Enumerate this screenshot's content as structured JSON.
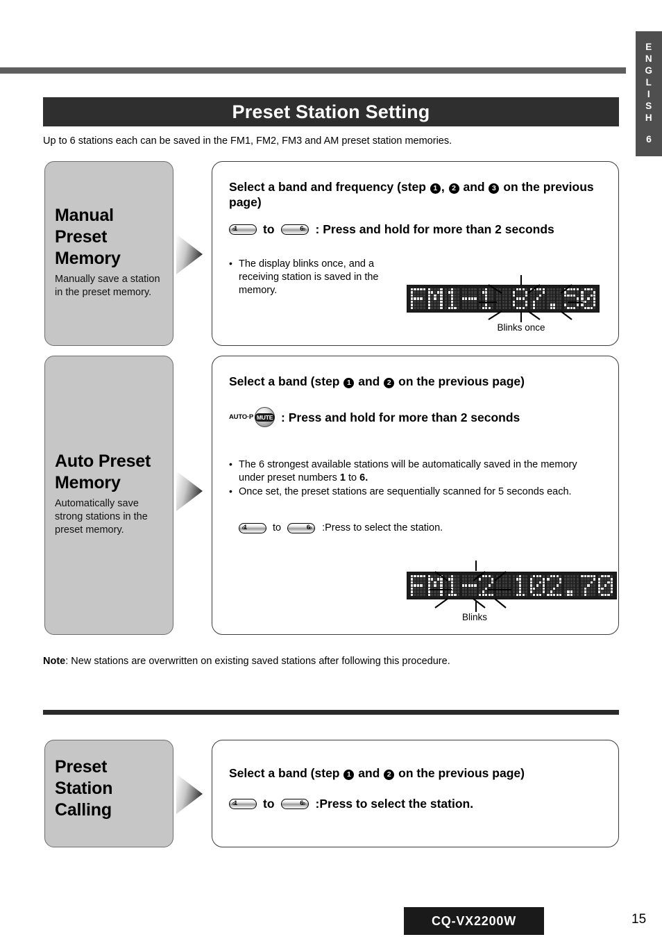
{
  "sidebar": {
    "language": "ENGLISH",
    "chapter": "6"
  },
  "header": {
    "title": "Preset Station Setting",
    "intro": "Up to 6 stations each can be saved in the FM1, FM2, FM3 and AM preset station memories."
  },
  "sections": [
    {
      "panel_title_lines": [
        "Manual",
        "Preset",
        "Memory"
      ],
      "panel_sub": "Manually save a station in the preset memory.",
      "step_head_a": "Select a band and frequency (step",
      "step_head_nums": [
        "1",
        "2",
        "3"
      ],
      "step_head_b": "on the previous page)",
      "btn_low": "1",
      "btn_high": "6",
      "to_word": "to",
      "action": ": Press and hold for more than 2 seconds",
      "bullets": [
        "The display blinks once, and a receiving station is saved in the memory."
      ],
      "display": "FM1-1  87.50",
      "display_caption": "Blinks once"
    },
    {
      "panel_title_lines": [
        "Auto Preset",
        "Memory"
      ],
      "panel_sub": "Automatically save strong stations in the preset memory.",
      "step_head_a": "Select a band (step",
      "step_head_nums": [
        "1",
        "2"
      ],
      "step_head_b": "on the previous page)",
      "autop_label": "AUTO·P",
      "mute_label": "MUTE",
      "action": ": Press and hold for more than 2 seconds",
      "bullets": [
        "The 6 strongest available stations will be automatically saved in the memory  under preset numbers 1 to 6.",
        "Once set, the preset stations are sequentially scanned for 5 seconds each."
      ],
      "bullet1_pre": "The 6 strongest available stations will be automatically saved in the memory  under preset numbers",
      "bullet1_bold_a": "1",
      "bullet1_mid": "to",
      "bullet1_bold_b": "6.",
      "btn_low": "1",
      "btn_high": "6",
      "to_word": "to",
      "sub_action": ":Press to select the station.",
      "display": "FM1-2 102.70",
      "display_caption": "Blinks"
    },
    {
      "panel_title_lines": [
        "Preset",
        "Station",
        "Calling"
      ],
      "step_head_a": "Select a band (step",
      "step_head_nums": [
        "1",
        "2"
      ],
      "step_head_b": "on the previous page)",
      "btn_low": "1",
      "btn_high": "6",
      "to_word": "to",
      "action": ":Press to select the station."
    }
  ],
  "note": {
    "label": "Note",
    "text": ": New stations are overwritten on existing saved stations after following this procedure."
  },
  "footer": {
    "model": "CQ-VX2200W",
    "page_number": "15"
  },
  "lcd": {
    "display_1_text": "FM1-1 87.50",
    "display_2_text": "FM1-2 102.70"
  }
}
